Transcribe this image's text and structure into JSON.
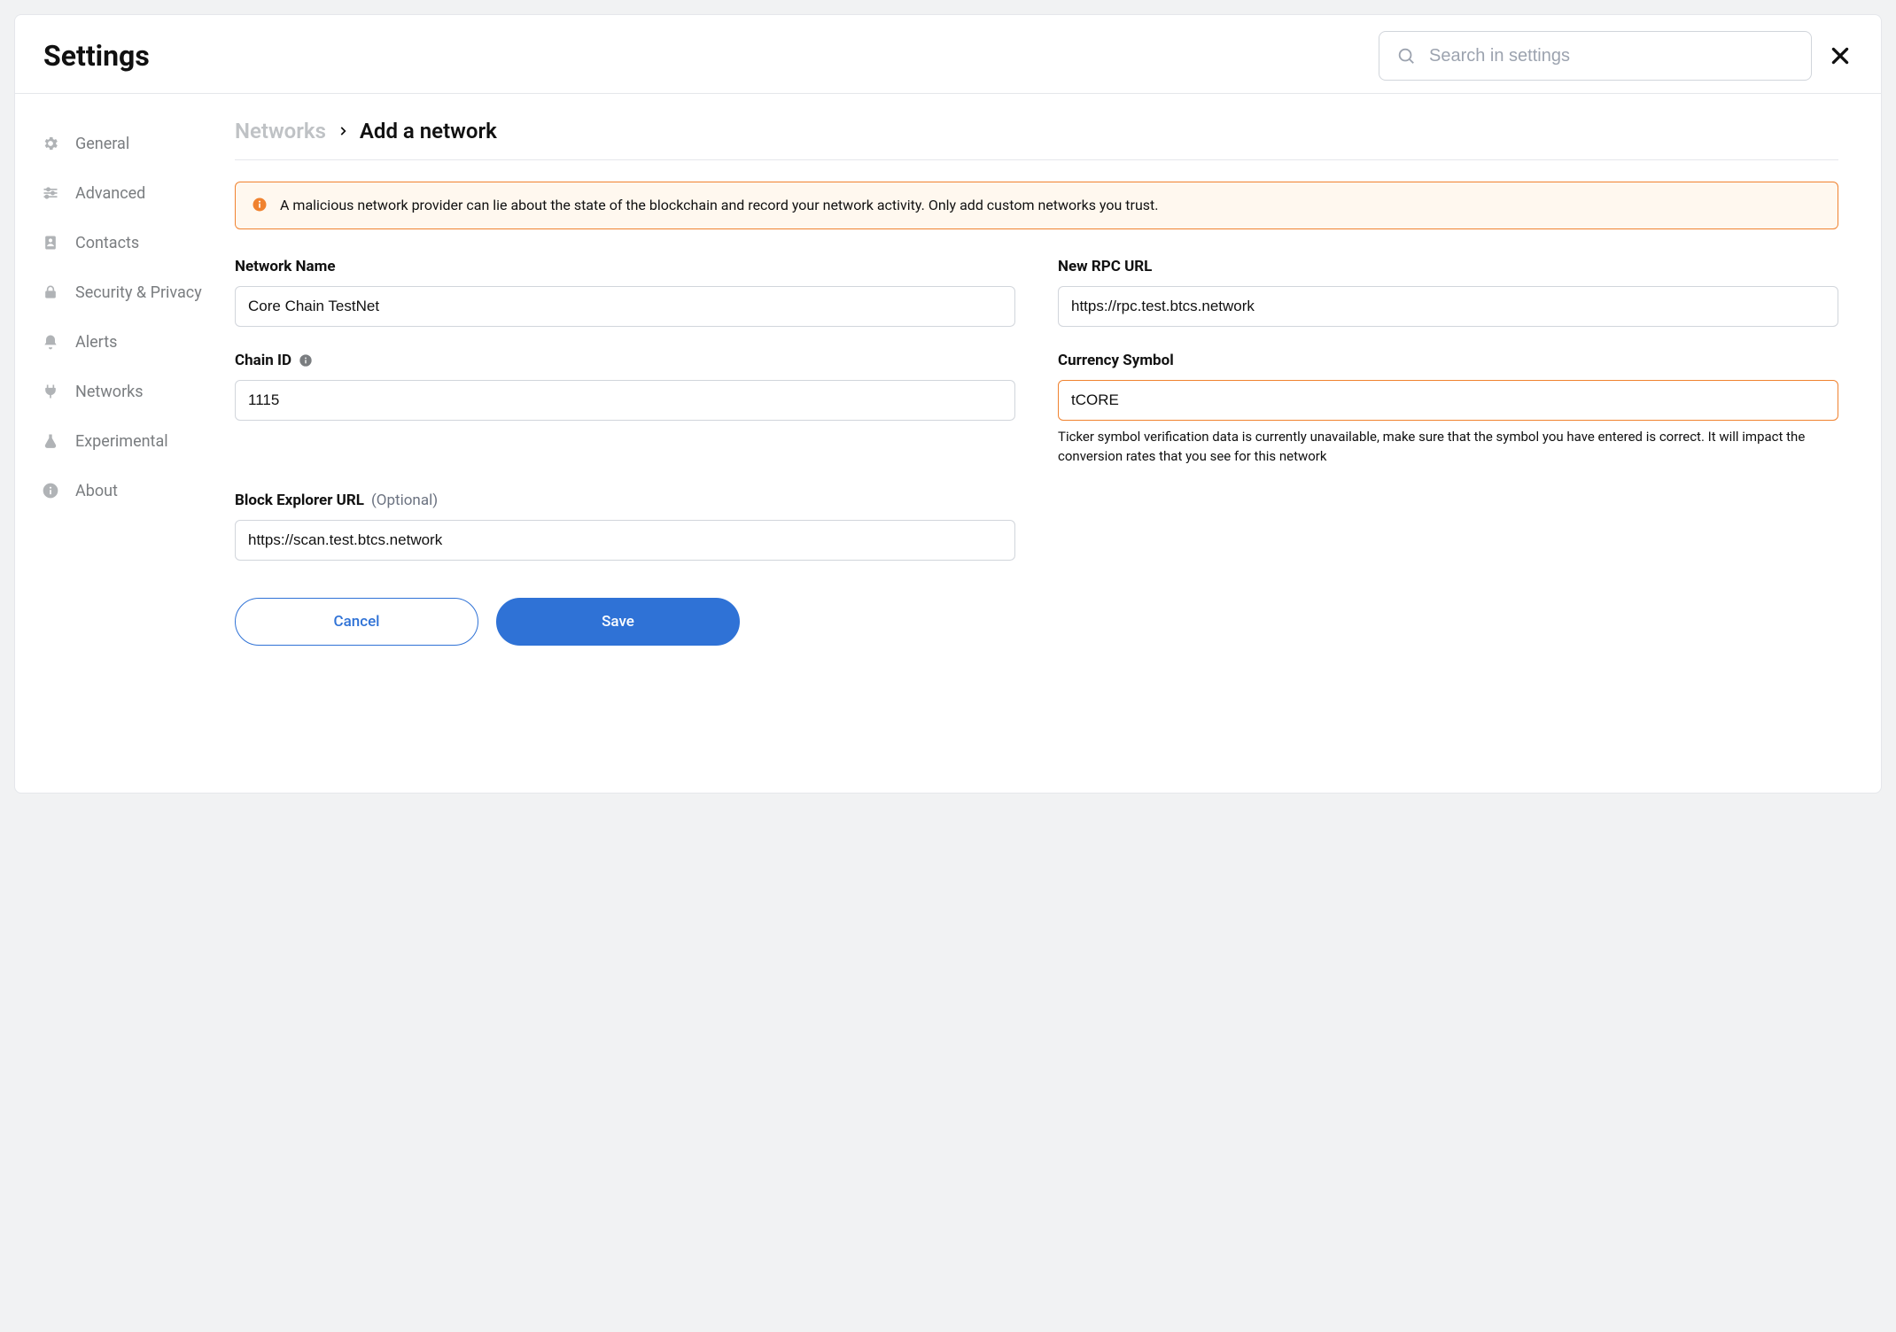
{
  "header": {
    "title": "Settings",
    "search_placeholder": "Search in settings"
  },
  "sidebar": {
    "items": [
      {
        "label": "General"
      },
      {
        "label": "Advanced"
      },
      {
        "label": "Contacts"
      },
      {
        "label": "Security & Privacy"
      },
      {
        "label": "Alerts"
      },
      {
        "label": "Networks"
      },
      {
        "label": "Experimental"
      },
      {
        "label": "About"
      }
    ]
  },
  "breadcrumb": {
    "parent": "Networks",
    "current": "Add a network"
  },
  "warning": {
    "text": "A malicious network provider can lie about the state of the blockchain and record your network activity. Only add custom networks you trust."
  },
  "fields": {
    "network_name": {
      "label": "Network Name",
      "value": "Core Chain TestNet"
    },
    "rpc_url": {
      "label": "New RPC URL",
      "value": "https://rpc.test.btcs.network"
    },
    "chain_id": {
      "label": "Chain ID",
      "value": "1115"
    },
    "currency_symbol": {
      "label": "Currency Symbol",
      "value": "tCORE",
      "help": "Ticker symbol verification data is currently unavailable, make sure that the symbol you have entered is correct. It will impact the conversion rates that you see for this network"
    },
    "block_explorer": {
      "label": "Block Explorer URL",
      "optional": "(Optional)",
      "value": "https://scan.test.btcs.network"
    }
  },
  "actions": {
    "cancel": "Cancel",
    "save": "Save"
  }
}
